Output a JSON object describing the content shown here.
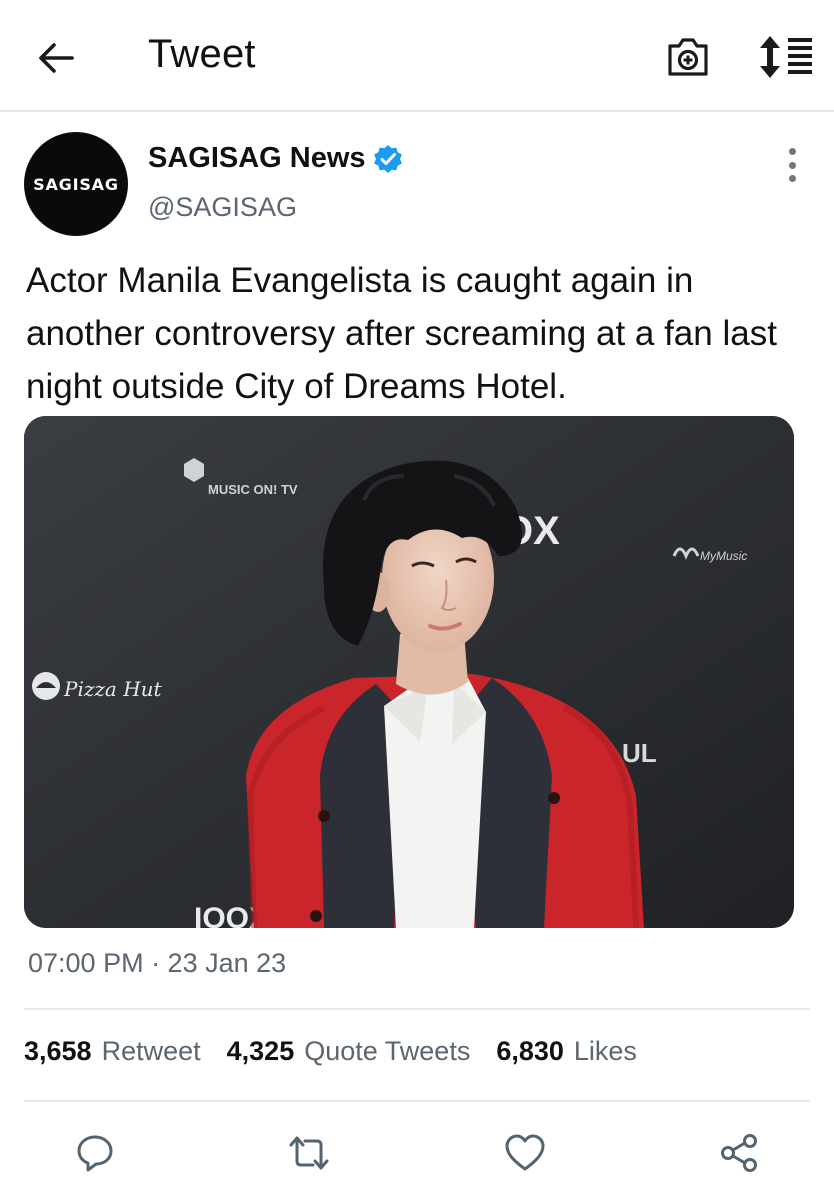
{
  "header": {
    "title": "Tweet",
    "icons": [
      "back-arrow-icon",
      "camera-plus-icon",
      "sort-icon"
    ]
  },
  "author": {
    "display_name": "SAGISAG News",
    "handle": "@SAGISAG",
    "avatar_text": "SAGISAG",
    "verified": true
  },
  "tweet": {
    "text": "Actor Manila Evangelista is caught again in another controversy after screaming at a fan last night outside City of Dreams Hotel.",
    "timestamp": "07:00 PM · 23 Jan 23"
  },
  "media": {
    "backdrop_texts": [
      "MUSIC ON! TV",
      "MyMusic",
      "Pizza Hut",
      "OX",
      "UL",
      "IOOX"
    ]
  },
  "stats": [
    {
      "count": "3,658",
      "label": "Retweet"
    },
    {
      "count": "4,325",
      "label": "Quote Tweets"
    },
    {
      "count": "6,830",
      "label": "Likes"
    }
  ],
  "actions": [
    "reply-icon",
    "retweet-icon",
    "like-icon",
    "share-icon"
  ],
  "colors": {
    "verified": "#1d9bf0",
    "secondary_text": "#5b6670",
    "divider": "#e7e9eb",
    "cardigan": "#c9252b"
  }
}
